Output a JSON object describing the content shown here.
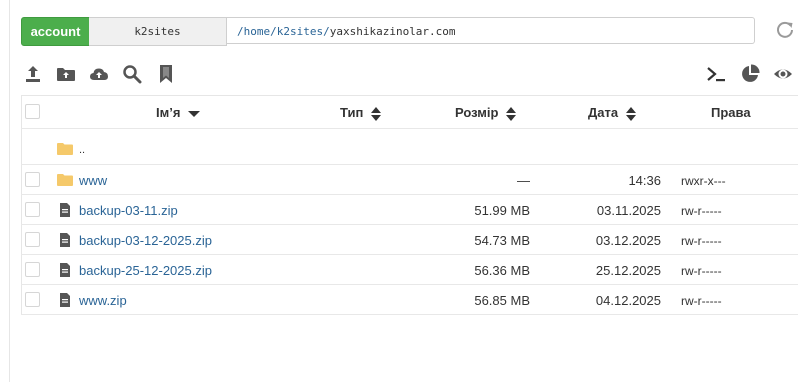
{
  "topbar": {
    "account_label": "account",
    "site_label": "k2sites",
    "path_link": "/home/k2sites/",
    "path_current": "yaxshikazinolar.com"
  },
  "toolbar": {
    "icons": [
      "upload-icon",
      "new-folder-icon",
      "cloud-upload-icon",
      "search-icon",
      "bookmark-icon",
      "terminal-icon",
      "pie-chart-icon",
      "eye-icon"
    ]
  },
  "table": {
    "headers": {
      "name": "Ім’я",
      "type": "Тип",
      "size": "Розмір",
      "date": "Дата",
      "perms": "Права"
    },
    "updir_label": "..",
    "rows": [
      {
        "name": "www",
        "type": "folder",
        "size": "—",
        "date": "14:36",
        "perms": "rwxr-x---"
      },
      {
        "name": "backup-03-11.zip",
        "type": "file",
        "size": "51.99 MB",
        "date": "03.11.2025",
        "perms": "rw-r-----"
      },
      {
        "name": "backup-03-12-2025.zip",
        "type": "file",
        "size": "54.73 MB",
        "date": "03.12.2025",
        "perms": "rw-r-----"
      },
      {
        "name": "backup-25-12-2025.zip",
        "type": "file",
        "size": "56.36 MB",
        "date": "25.12.2025",
        "perms": "rw-r-----"
      },
      {
        "name": "www.zip",
        "type": "file",
        "size": "56.85 MB",
        "date": "04.12.2025",
        "perms": "rw-r-----"
      }
    ]
  },
  "colors": {
    "accent_green": "#4cae4c",
    "link_blue": "#2a6496",
    "folder_yellow": "#f5c96a",
    "icon_gray": "#555555"
  }
}
